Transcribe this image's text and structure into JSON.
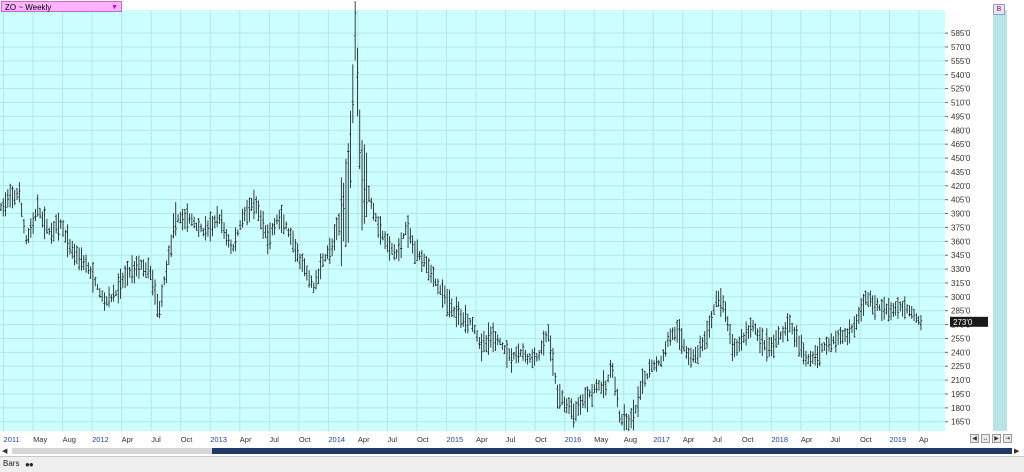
{
  "symbol_selector": {
    "value": "ZO ~ Weekly"
  },
  "corner_badge": "B",
  "bottom_tab": "Bars",
  "colors": {
    "plot_bg": "#ccffff",
    "grid": "#b3e6e6",
    "bar": "#111111",
    "axis_text": "#333333",
    "x_label": "#2244aa",
    "price_box_bg": "#1a1a1a",
    "price_box_text": "#ffffff"
  },
  "chart_data": {
    "type": "bar",
    "subtype": "ohlc",
    "title": "ZO ~ Weekly",
    "ylim": [
      155,
      610
    ],
    "y_ticks": [
      165,
      180,
      195,
      210,
      225,
      240,
      255,
      270,
      285,
      300,
      315,
      330,
      345,
      360,
      375,
      390,
      405,
      420,
      435,
      450,
      465,
      480,
      495,
      510,
      525,
      540,
      555,
      570,
      585
    ],
    "tick_suffix": "'0",
    "x_labels": [
      "2011",
      "May",
      "Aug",
      "2012",
      "Apr",
      "Jul",
      "Oct",
      "2013",
      "Apr",
      "Jul",
      "Oct",
      "2014",
      "Apr",
      "Jul",
      "Oct",
      "2015",
      "Apr",
      "Jul",
      "Oct",
      "2016",
      "May",
      "Aug",
      "2017",
      "Apr",
      "Jul",
      "Oct",
      "2018",
      "Apr",
      "Jul",
      "Oct",
      "2019",
      "Ap"
    ],
    "x_label_years": [
      "2011",
      "2012",
      "2013",
      "2014",
      "2015",
      "2016",
      "2017",
      "2018",
      "2019"
    ],
    "x_range": [
      0,
      1
    ],
    "last_price": "273'0",
    "last_value": 273,
    "anchors": [
      [
        0.0,
        395
      ],
      [
        0.01,
        405
      ],
      [
        0.02,
        412
      ],
      [
        0.028,
        360
      ],
      [
        0.04,
        395
      ],
      [
        0.052,
        370
      ],
      [
        0.064,
        378
      ],
      [
        0.076,
        350
      ],
      [
        0.088,
        340
      ],
      [
        0.1,
        318
      ],
      [
        0.11,
        295
      ],
      [
        0.12,
        300
      ],
      [
        0.134,
        325
      ],
      [
        0.148,
        335
      ],
      [
        0.16,
        325
      ],
      [
        0.168,
        282
      ],
      [
        0.176,
        330
      ],
      [
        0.186,
        385
      ],
      [
        0.2,
        385
      ],
      [
        0.216,
        370
      ],
      [
        0.232,
        385
      ],
      [
        0.246,
        350
      ],
      [
        0.258,
        390
      ],
      [
        0.27,
        400
      ],
      [
        0.284,
        362
      ],
      [
        0.294,
        385
      ],
      [
        0.302,
        378
      ],
      [
        0.312,
        350
      ],
      [
        0.322,
        330
      ],
      [
        0.332,
        310
      ],
      [
        0.342,
        340
      ],
      [
        0.352,
        355
      ],
      [
        0.362,
        390
      ],
      [
        0.37,
        425
      ],
      [
        0.376,
        600
      ],
      [
        0.382,
        440
      ],
      [
        0.39,
        410
      ],
      [
        0.4,
        378
      ],
      [
        0.41,
        355
      ],
      [
        0.42,
        345
      ],
      [
        0.43,
        375
      ],
      [
        0.44,
        348
      ],
      [
        0.45,
        340
      ],
      [
        0.46,
        318
      ],
      [
        0.47,
        300
      ],
      [
        0.48,
        285
      ],
      [
        0.49,
        278
      ],
      [
        0.5,
        272
      ],
      [
        0.51,
        245
      ],
      [
        0.52,
        258
      ],
      [
        0.53,
        250
      ],
      [
        0.54,
        235
      ],
      [
        0.55,
        240
      ],
      [
        0.56,
        232
      ],
      [
        0.57,
        235
      ],
      [
        0.58,
        262
      ],
      [
        0.59,
        195
      ],
      [
        0.6,
        182
      ],
      [
        0.608,
        175
      ],
      [
        0.616,
        188
      ],
      [
        0.624,
        195
      ],
      [
        0.632,
        205
      ],
      [
        0.64,
        200
      ],
      [
        0.648,
        225
      ],
      [
        0.656,
        168
      ],
      [
        0.664,
        162
      ],
      [
        0.672,
        175
      ],
      [
        0.68,
        205
      ],
      [
        0.69,
        225
      ],
      [
        0.7,
        230
      ],
      [
        0.71,
        262
      ],
      [
        0.72,
        258
      ],
      [
        0.73,
        232
      ],
      [
        0.74,
        242
      ],
      [
        0.75,
        262
      ],
      [
        0.758,
        300
      ],
      [
        0.766,
        290
      ],
      [
        0.776,
        242
      ],
      [
        0.786,
        255
      ],
      [
        0.796,
        270
      ],
      [
        0.806,
        252
      ],
      [
        0.816,
        245
      ],
      [
        0.826,
        258
      ],
      [
        0.836,
        272
      ],
      [
        0.846,
        245
      ],
      [
        0.856,
        232
      ],
      [
        0.866,
        240
      ],
      [
        0.876,
        250
      ],
      [
        0.886,
        255
      ],
      [
        0.896,
        258
      ],
      [
        0.906,
        272
      ],
      [
        0.916,
        300
      ],
      [
        0.926,
        292
      ],
      [
        0.936,
        285
      ],
      [
        0.946,
        285
      ],
      [
        0.956,
        290
      ],
      [
        0.966,
        282
      ],
      [
        0.975,
        273
      ]
    ]
  }
}
